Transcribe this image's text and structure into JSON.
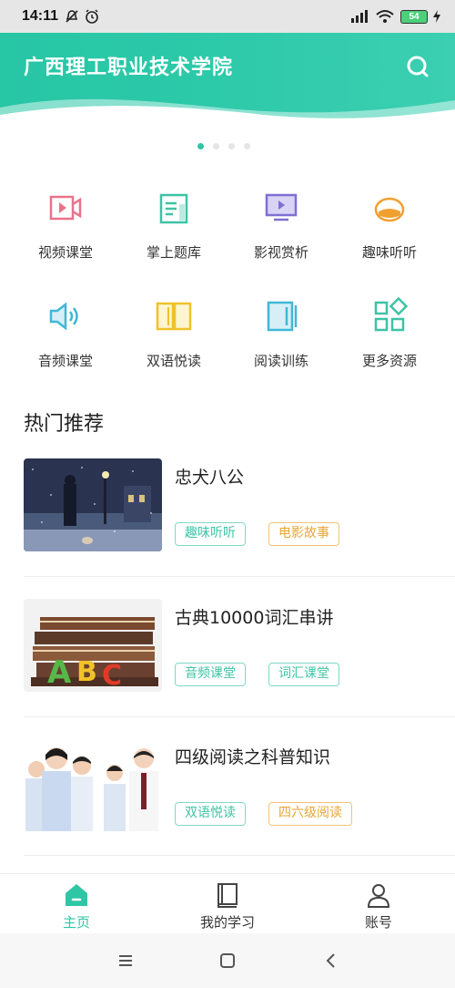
{
  "status_bar": {
    "time": "14:11",
    "battery": "54"
  },
  "header": {
    "title": "广西理工职业技术学院"
  },
  "carousel": {
    "page_count": 4,
    "active_index": 0
  },
  "grid": [
    {
      "label": "视频课堂",
      "icon": "video-icon",
      "color": "#e9738a"
    },
    {
      "label": "掌上题库",
      "icon": "question-bank-icon",
      "color": "#3ec3a5"
    },
    {
      "label": "影视赏析",
      "icon": "film-screen-icon",
      "color": "#7e6fd4"
    },
    {
      "label": "趣味听听",
      "icon": "headphones-icon",
      "color": "#f0a030"
    },
    {
      "label": "音频课堂",
      "icon": "speaker-icon",
      "color": "#3fb7d8"
    },
    {
      "label": "双语悦读",
      "icon": "open-book-icon",
      "color": "#f0c22a"
    },
    {
      "label": "阅读训练",
      "icon": "reading-icon",
      "color": "#3fb7d8"
    },
    {
      "label": "更多资源",
      "icon": "more-apps-icon",
      "color": "#3ec3a5"
    }
  ],
  "section": {
    "title": "热门推荐"
  },
  "recommendations": [
    {
      "title": "忠犬八公",
      "tags": [
        {
          "label": "趣味听听",
          "color": "green"
        },
        {
          "label": "电影故事",
          "color": "orange"
        }
      ]
    },
    {
      "title": "古典10000词汇串讲",
      "tags": [
        {
          "label": "音频课堂",
          "color": "green"
        },
        {
          "label": "词汇课堂",
          "color": "green"
        }
      ]
    },
    {
      "title": "四级阅读之科普知识",
      "tags": [
        {
          "label": "双语悦读",
          "color": "green"
        },
        {
          "label": "四六级阅读",
          "color": "orange"
        }
      ]
    }
  ],
  "bottom_nav": [
    {
      "label": "主页",
      "icon": "home-icon",
      "active": true
    },
    {
      "label": "我的学习",
      "icon": "book-icon",
      "active": false
    },
    {
      "label": "账号",
      "icon": "user-icon",
      "active": false
    }
  ],
  "colors": {
    "accent": "#2ec7a6",
    "tag_green": "#3ec3a5",
    "tag_orange": "#e9a632"
  }
}
